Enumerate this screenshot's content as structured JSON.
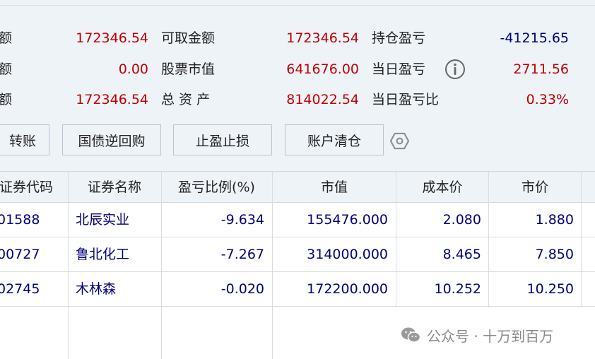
{
  "summary": {
    "col1": [
      {
        "label": "额",
        "value": "172346.54"
      },
      {
        "label": "额",
        "value": "0.00"
      },
      {
        "label": "额",
        "value": "172346.54"
      }
    ],
    "col2": [
      {
        "label": "可取金额",
        "value": "172346.54"
      },
      {
        "label": "股票市值",
        "value": "641676.00"
      },
      {
        "label": "总 资 产",
        "value": "814022.54"
      }
    ],
    "col3": [
      {
        "label": "持仓盈亏",
        "value": "-41215.65"
      },
      {
        "label": "当日盈亏",
        "value": "2711.56"
      },
      {
        "label": "当日盈亏比",
        "value": "0.33%"
      }
    ]
  },
  "buttons": {
    "transfer": "转账",
    "bond_repo": "国债逆回购",
    "stop_profit_loss": "止盈止损",
    "clear_account": "账户清仓"
  },
  "icons": {
    "info": "info-circle-icon",
    "settings": "hexagon-gear-icon",
    "watermark": "wechat-icon"
  },
  "table": {
    "headers": [
      "证券代码",
      "证券名称",
      "盈亏比例(%)",
      "市值",
      "成本价",
      "市价"
    ],
    "rows": [
      {
        "code": "01588",
        "name": "北辰实业",
        "pl_pct": "-9.634",
        "market_value": "155476.000",
        "cost": "2.080",
        "price": "1.880"
      },
      {
        "code": "00727",
        "name": "鲁北化工",
        "pl_pct": "-7.267",
        "market_value": "314000.000",
        "cost": "8.465",
        "price": "7.850"
      },
      {
        "code": "02745",
        "name": "木林森",
        "pl_pct": "-0.020",
        "market_value": "172200.000",
        "cost": "10.252",
        "price": "10.250"
      }
    ]
  },
  "watermark": {
    "text": "公众号 · 十万到百万"
  },
  "colors": {
    "positive": "#c00000",
    "negative": "#00007a",
    "panel_bg": "#eef3f8"
  }
}
